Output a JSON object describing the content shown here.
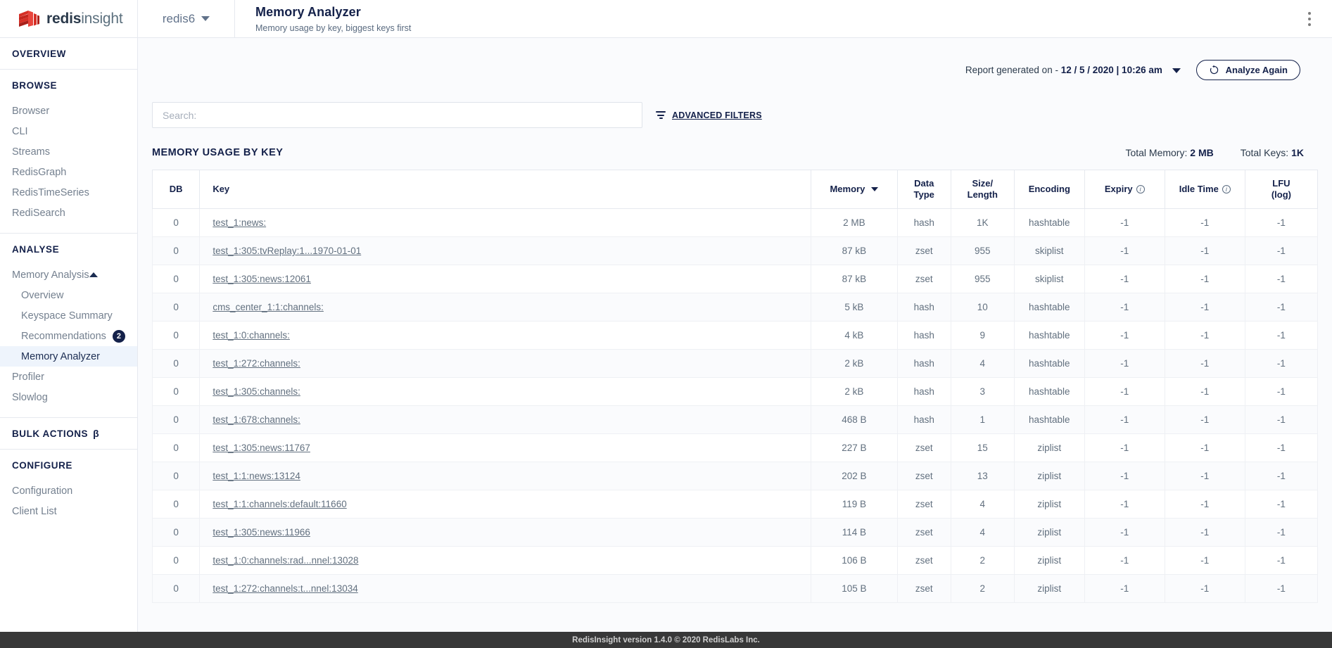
{
  "app": {
    "logo_bold": "redis",
    "logo_light": "insight",
    "logo_icon": "redis-cube-icon"
  },
  "topbar": {
    "database_name": "redis6",
    "database_chevron_icon": "chevron-down-icon",
    "page_title": "Memory Analyzer",
    "page_subtitle": "Memory usage by key, biggest keys first",
    "overflow_menu_icon": "kebab-menu-icon"
  },
  "sidebar": {
    "sections": [
      {
        "label": "OVERVIEW",
        "items": []
      },
      {
        "label": "BROWSE",
        "items": [
          {
            "label": "Browser"
          },
          {
            "label": "CLI"
          },
          {
            "label": "Streams"
          },
          {
            "label": "RedisGraph"
          },
          {
            "label": "RedisTimeSeries"
          },
          {
            "label": "RediSearch"
          }
        ]
      },
      {
        "label": "ANALYSE",
        "items": [
          {
            "label": "Memory Analysis",
            "expanded": true,
            "arrow_icon": "chevron-up-icon"
          },
          {
            "label": "Overview",
            "sub": true
          },
          {
            "label": "Keyspace Summary",
            "sub": true
          },
          {
            "label": "Recommendations",
            "sub": true,
            "badge": "2"
          },
          {
            "label": "Memory Analyzer",
            "sub": true,
            "active": true
          },
          {
            "label": "Profiler"
          },
          {
            "label": "Slowlog"
          }
        ]
      },
      {
        "label": "BULK ACTIONS",
        "beta": "β",
        "items": []
      },
      {
        "label": "CONFIGURE",
        "items": [
          {
            "label": "Configuration"
          },
          {
            "label": "Client List"
          }
        ]
      }
    ]
  },
  "report": {
    "prefix": "Report generated on -",
    "timestamp": "12 / 5 / 2020 | 10:26 am",
    "dropdown_icon": "chevron-down-icon",
    "analyze_button_label": "Analyze Again",
    "analyze_button_icon": "refresh-icon"
  },
  "search": {
    "placeholder": "Search:",
    "value": "",
    "advanced_filters_label": "ADVANCED FILTERS",
    "filter_icon": "filter-icon"
  },
  "section": {
    "title": "MEMORY USAGE BY KEY",
    "total_memory_label": "Total Memory:",
    "total_memory_value": "2 MB",
    "total_keys_label": "Total Keys:",
    "total_keys_value": "1K"
  },
  "table": {
    "columns": [
      {
        "label": "DB"
      },
      {
        "label": "Key"
      },
      {
        "label": "Memory",
        "sorted": true,
        "sort_icon": "sort-desc-icon"
      },
      {
        "label": "Data\nType"
      },
      {
        "label": "Size/\nLength"
      },
      {
        "label": "Encoding"
      },
      {
        "label": "Expiry",
        "info": true
      },
      {
        "label": "Idle Time",
        "info": true
      },
      {
        "label": "LFU\n(log)"
      }
    ],
    "rows": [
      {
        "db": "0",
        "key": "test_1:news:",
        "memory": "2 MB",
        "type": "hash",
        "size": "1K",
        "encoding": "hashtable",
        "expiry": "-1",
        "idle": "-1",
        "lfu": "-1"
      },
      {
        "db": "0",
        "key": "test_1:305:tvReplay:1...1970-01-01",
        "memory": "87 kB",
        "type": "zset",
        "size": "955",
        "encoding": "skiplist",
        "expiry": "-1",
        "idle": "-1",
        "lfu": "-1"
      },
      {
        "db": "0",
        "key": "test_1:305:news:12061",
        "memory": "87 kB",
        "type": "zset",
        "size": "955",
        "encoding": "skiplist",
        "expiry": "-1",
        "idle": "-1",
        "lfu": "-1"
      },
      {
        "db": "0",
        "key": "cms_center_1:1:channels:",
        "memory": "5 kB",
        "type": "hash",
        "size": "10",
        "encoding": "hashtable",
        "expiry": "-1",
        "idle": "-1",
        "lfu": "-1"
      },
      {
        "db": "0",
        "key": "test_1:0:channels:",
        "memory": "4 kB",
        "type": "hash",
        "size": "9",
        "encoding": "hashtable",
        "expiry": "-1",
        "idle": "-1",
        "lfu": "-1"
      },
      {
        "db": "0",
        "key": "test_1:272:channels:",
        "memory": "2 kB",
        "type": "hash",
        "size": "4",
        "encoding": "hashtable",
        "expiry": "-1",
        "idle": "-1",
        "lfu": "-1"
      },
      {
        "db": "0",
        "key": "test_1:305:channels:",
        "memory": "2 kB",
        "type": "hash",
        "size": "3",
        "encoding": "hashtable",
        "expiry": "-1",
        "idle": "-1",
        "lfu": "-1"
      },
      {
        "db": "0",
        "key": "test_1:678:channels:",
        "memory": "468 B",
        "type": "hash",
        "size": "1",
        "encoding": "hashtable",
        "expiry": "-1",
        "idle": "-1",
        "lfu": "-1"
      },
      {
        "db": "0",
        "key": "test_1:305:news:11767",
        "memory": "227 B",
        "type": "zset",
        "size": "15",
        "encoding": "ziplist",
        "expiry": "-1",
        "idle": "-1",
        "lfu": "-1"
      },
      {
        "db": "0",
        "key": "test_1:1:news:13124",
        "memory": "202 B",
        "type": "zset",
        "size": "13",
        "encoding": "ziplist",
        "expiry": "-1",
        "idle": "-1",
        "lfu": "-1"
      },
      {
        "db": "0",
        "key": "test_1:1:channels:default:11660",
        "memory": "119 B",
        "type": "zset",
        "size": "4",
        "encoding": "ziplist",
        "expiry": "-1",
        "idle": "-1",
        "lfu": "-1"
      },
      {
        "db": "0",
        "key": "test_1:305:news:11966",
        "memory": "114 B",
        "type": "zset",
        "size": "4",
        "encoding": "ziplist",
        "expiry": "-1",
        "idle": "-1",
        "lfu": "-1"
      },
      {
        "db": "0",
        "key": "test_1:0:channels:rad...nnel:13028",
        "memory": "106 B",
        "type": "zset",
        "size": "2",
        "encoding": "ziplist",
        "expiry": "-1",
        "idle": "-1",
        "lfu": "-1"
      },
      {
        "db": "0",
        "key": "test_1:272:channels:t...nnel:13034",
        "memory": "105 B",
        "type": "zset",
        "size": "2",
        "encoding": "ziplist",
        "expiry": "-1",
        "idle": "-1",
        "lfu": "-1"
      }
    ]
  },
  "footer": {
    "text": "RedisInsight version 1.4.0 © 2020 RedisLabs Inc."
  },
  "colors": {
    "brand_red": "#d62f26",
    "navy": "#14214a",
    "active_row_bg": "#eef4fc",
    "page_bg": "#fafbfd",
    "footer_bg": "#383838"
  }
}
